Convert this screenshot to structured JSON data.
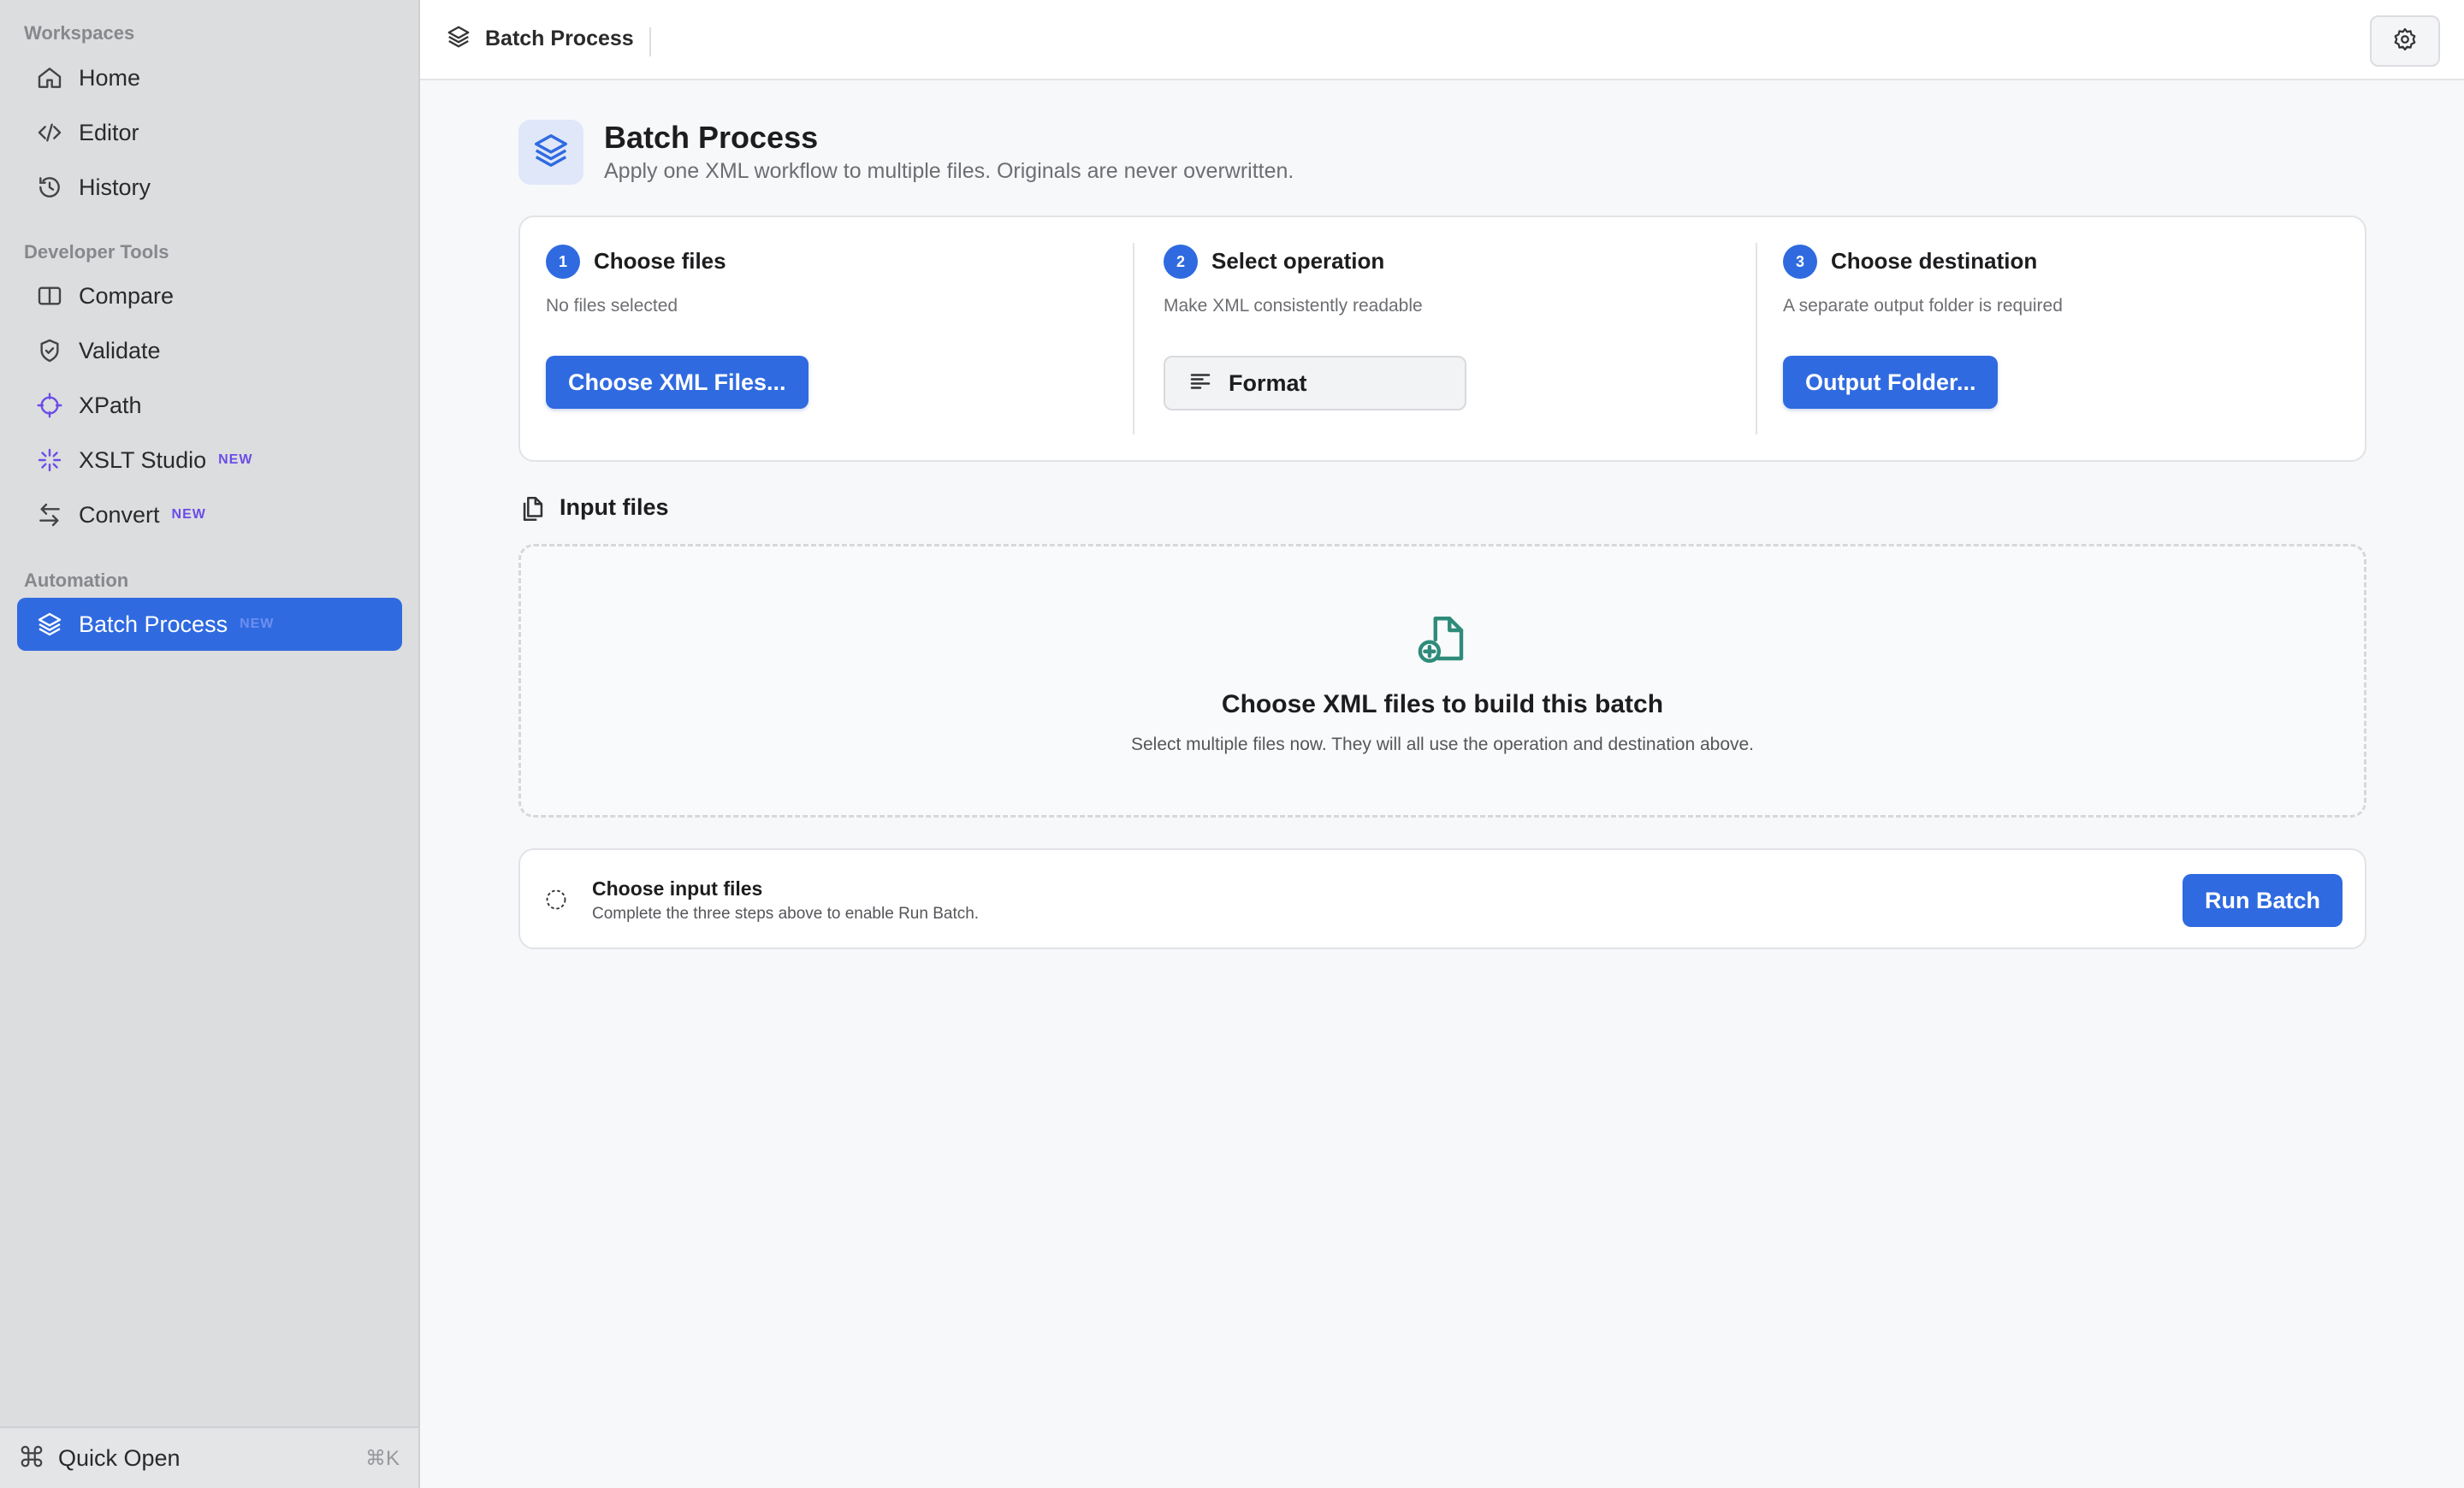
{
  "sidebar": {
    "sections": [
      {
        "title": "Workspaces"
      },
      {
        "title": "Developer Tools"
      },
      {
        "title": "Automation"
      }
    ],
    "items": [
      {
        "label": "Home",
        "icon": "home-icon"
      },
      {
        "label": "Editor",
        "icon": "code-icon"
      },
      {
        "label": "History",
        "icon": "history-icon"
      },
      {
        "label": "Compare",
        "icon": "columns-icon"
      },
      {
        "label": "Validate",
        "icon": "shield-check-icon"
      },
      {
        "label": "XPath",
        "icon": "crosshair-icon"
      },
      {
        "label": "XSLT Studio",
        "icon": "sparkle-icon",
        "badge": "NEW"
      },
      {
        "label": "Convert",
        "icon": "arrows-swap-icon",
        "badge": "NEW"
      },
      {
        "label": "Batch Process",
        "icon": "layers-icon",
        "badge": "NEW",
        "active": true
      }
    ],
    "quick_open": {
      "label": "Quick Open",
      "shortcut": "⌘K"
    }
  },
  "topbar": {
    "breadcrumb": "Batch Process"
  },
  "page": {
    "title": "Batch Process",
    "subtitle": "Apply one XML workflow to multiple files. Originals are never overwritten."
  },
  "steps": [
    {
      "number": "1",
      "title": "Choose files",
      "description": "No files selected",
      "button": "Choose XML Files..."
    },
    {
      "number": "2",
      "title": "Select operation",
      "description": "Make XML consistently readable",
      "button": "Format"
    },
    {
      "number": "3",
      "title": "Choose destination",
      "description": "A separate output folder is required",
      "button": "Output Folder..."
    }
  ],
  "input_files": {
    "title": "Input files",
    "empty_title": "Choose XML files to build this batch",
    "empty_description": "Select multiple files now. They will all use the operation and destination above."
  },
  "status": {
    "title": "Choose input files",
    "description": "Complete the three steps above to enable Run Batch.",
    "run_button": "Run Batch"
  },
  "colors": {
    "accent": "#2f6ae0",
    "sidebar_bg": "#dcdddf",
    "badge": "#6b4de6",
    "drop_icon": "#2e8b7a"
  }
}
